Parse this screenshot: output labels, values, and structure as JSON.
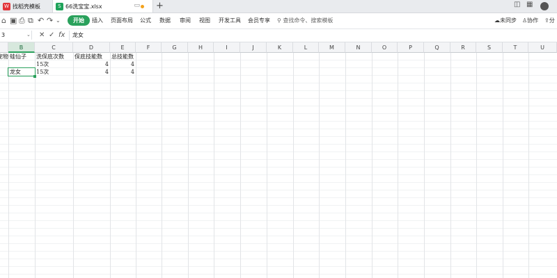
{
  "tabs": [
    {
      "label": "找稻壳模板",
      "icon": "wps-logo-icon"
    },
    {
      "label": "66洗宝宝.xlsx",
      "icon": "spreadsheet-file-icon"
    }
  ],
  "menu": [
    "开始",
    "插入",
    "页面布局",
    "公式",
    "数据",
    "审阅",
    "视图",
    "开发工具",
    "会员专享"
  ],
  "search_placeholder": "查找命令、搜索模板",
  "toolbar_right": {
    "sync": "未同步",
    "collab": "协作",
    "share": "分"
  },
  "namebox": "3",
  "formula": "龙女",
  "columns": [
    "B",
    "C",
    "D",
    "E",
    "F",
    "G",
    "H",
    "I",
    "J",
    "K",
    "L",
    "M",
    "N",
    "O",
    "P",
    "Q",
    "R",
    "S",
    "T",
    "U"
  ],
  "cells": {
    "a1": "宠物",
    "b1": "蛙仙子",
    "c1": "洗保底次数",
    "d1": "保底技能数",
    "e1": "总技能数",
    "b2": "龙女",
    "c2": "15次",
    "d2": "4",
    "e2": "4",
    "c3": "15次",
    "d3": "4",
    "e3": "4"
  },
  "colors": {
    "accent": "#2aa15c"
  }
}
